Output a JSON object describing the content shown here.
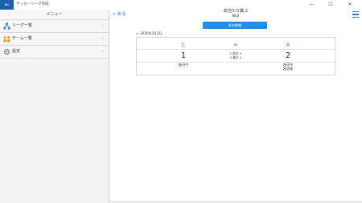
{
  "window": {
    "title": "サッカーリーグ作成",
    "back_glyph": "←",
    "minimize_glyph": "—",
    "maximize_glyph": "☐",
    "close_glyph": "✕"
  },
  "sidebar": {
    "header": "メニュー",
    "items": [
      {
        "label": "リーグ一覧",
        "icon": "org-chart-icon"
      },
      {
        "label": "チーム一覧",
        "icon": "team-icon"
      },
      {
        "label": "設定",
        "icon": "settings-icon"
      }
    ],
    "chevron_glyph": "›"
  },
  "main": {
    "back_label": "戻る",
    "back_glyph": "‹",
    "title": "総当たり戦 2",
    "subtitle": "No2",
    "info_button": "試合情報",
    "calendar_glyph": "▭",
    "date": "2016年2月3日",
    "match": {
      "home_team": "C",
      "away_team": "B",
      "vs_label": "vs",
      "home_score": "1",
      "away_score": "2",
      "first_half": "1 前半 0",
      "second_half": "0 後半 2",
      "home_scorers": [
        "⚽田中"
      ],
      "away_scorers": [
        "⚽田中",
        "⚽佐尾"
      ]
    }
  },
  "colors": {
    "accent": "#2b7fd6",
    "button": "#1f8ef1",
    "titlebar_back": "#1f5fa8"
  }
}
